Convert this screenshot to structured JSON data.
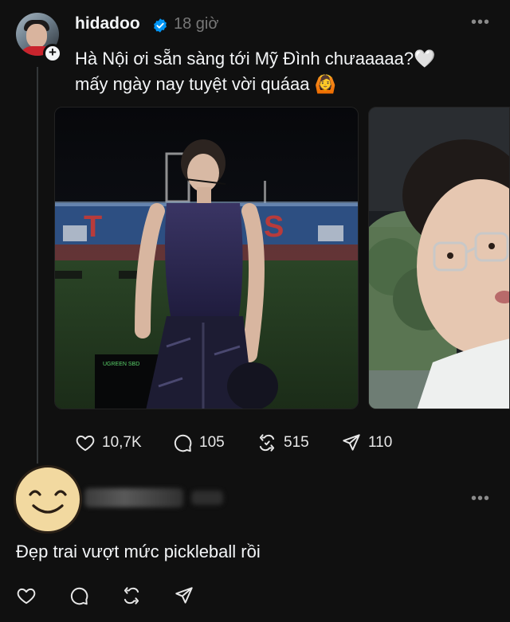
{
  "post": {
    "username": "hidadoo",
    "time": "18 giờ",
    "caption_line1": "Hà Nội ơi sẵn sàng tới Mỹ Đình chưaaaaa?🤍",
    "caption_line2": "mấy ngày nay tuyệt vời quáaa 🙆",
    "more": "•••",
    "stats": {
      "likes": "10,7K",
      "comments": "105",
      "reposts": "515",
      "shares": "110"
    },
    "icons": {
      "verified": "verified-badge-icon",
      "follow": "plus-icon",
      "like": "heart-icon",
      "comment": "comment-icon",
      "repost": "repost-icon",
      "share": "send-icon"
    },
    "stage_banner_text": "T  S",
    "stage_screen_text": "UGREEN SBD"
  },
  "reply": {
    "text": "Đẹp trai vượt mức pickleball rồi",
    "more": "•••",
    "icons": [
      "heart-icon",
      "comment-icon",
      "repost-icon",
      "send-icon"
    ]
  },
  "colors": {
    "background": "#101010",
    "text": "#f3f5f7",
    "muted": "#777777",
    "verified": "#0095f6"
  }
}
